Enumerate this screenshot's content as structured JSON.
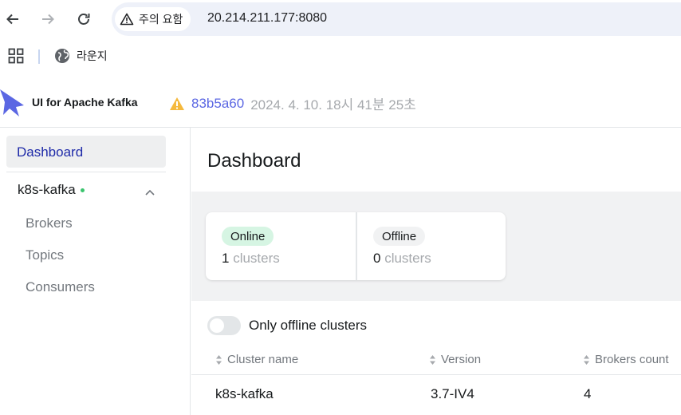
{
  "browser": {
    "security_label": "주의 요함",
    "url": "20.214.211.177:8080",
    "bookmark_label": "라운지"
  },
  "header": {
    "brand": "UI for Apache Kafka",
    "commit": "83b5a60",
    "build_date": "2024. 4. 10. 18시 41분 25초"
  },
  "sidebar": {
    "dashboard": "Dashboard",
    "cluster": "k8s-kafka",
    "items": [
      "Brokers",
      "Topics",
      "Consumers"
    ]
  },
  "main": {
    "title": "Dashboard",
    "metrics": {
      "online_label": "Online",
      "online_count": "1",
      "offline_label": "Offline",
      "offline_count": "0",
      "unit": "clusters"
    },
    "toggle_label": "Only offline clusters",
    "table": {
      "columns": [
        "Cluster name",
        "Version",
        "Brokers count"
      ],
      "rows": [
        [
          "k8s-kafka",
          "3.7-IV4",
          "4"
        ]
      ]
    }
  },
  "colors": {
    "accent": "#5b67e3",
    "online_pill": "#d6f5e3",
    "online_dot": "#3bc46e",
    "logo": "#5b67e3"
  },
  "icons": [
    "back-arrow-icon",
    "forward-arrow-icon",
    "reload-icon",
    "warning-triangle-icon",
    "apps-grid-icon",
    "globe-icon",
    "kafka-logo",
    "warning-icon",
    "chevron-up-icon",
    "sort-icon"
  ]
}
